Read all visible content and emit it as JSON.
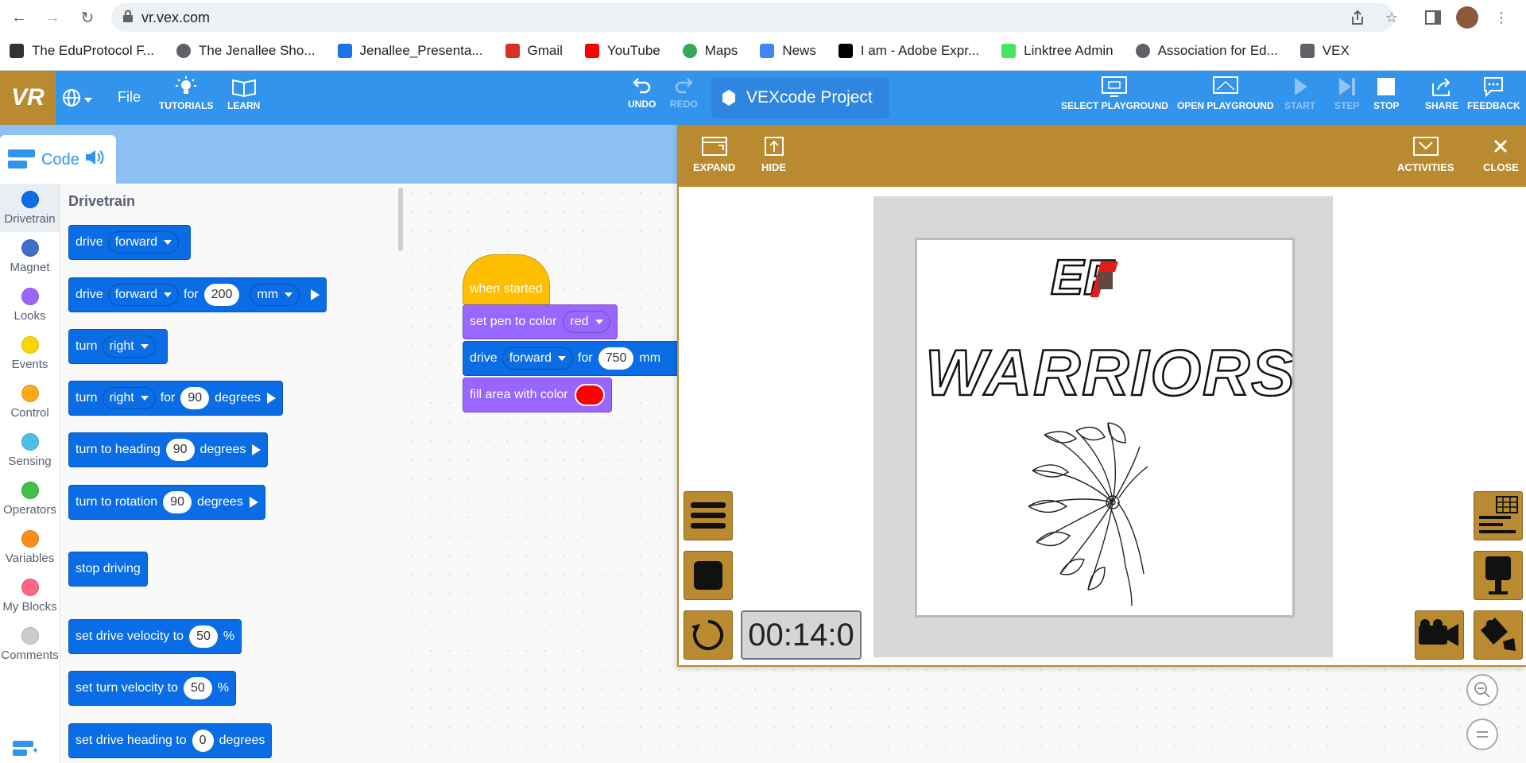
{
  "browser": {
    "url": "vr.vex.com",
    "bookmarks": [
      {
        "label": "The EduProtocol F...",
        "icon": "animal-icon",
        "color": "#333333"
      },
      {
        "label": "The Jenallee Sho...",
        "icon": "globe-icon",
        "color": "#5f6368"
      },
      {
        "label": "Jenallee_Presenta...",
        "icon": "w-logo-icon",
        "color": "#1a73e8"
      },
      {
        "label": "Gmail",
        "icon": "gmail-icon",
        "color": "#d93025"
      },
      {
        "label": "YouTube",
        "icon": "youtube-icon",
        "color": "#ff0000"
      },
      {
        "label": "Maps",
        "icon": "maps-pin-icon",
        "color": "#34a853"
      },
      {
        "label": "News",
        "icon": "news-icon",
        "color": "#4285f4"
      },
      {
        "label": "I am - Adobe Expr...",
        "icon": "adobe-icon",
        "color": "#000000"
      },
      {
        "label": "Linktree Admin",
        "icon": "linktree-icon",
        "color": "#43e660"
      },
      {
        "label": "Association for Ed...",
        "icon": "globe-icon",
        "color": "#5f6368"
      },
      {
        "label": "VEX",
        "icon": "folder-icon",
        "color": "#5f6368"
      }
    ]
  },
  "app": {
    "logo": "VR",
    "file_label": "File",
    "tutorials_label": "TUTORIALS",
    "learn_label": "LEARN",
    "undo_label": "UNDO",
    "redo_label": "REDO",
    "project_name": "VEXcode Project",
    "select_playground_label": "SELECT PLAYGROUND",
    "open_playground_label": "OPEN PLAYGROUND",
    "start_label": "START",
    "step_label": "STEP",
    "stop_label": "STOP",
    "share_label": "SHARE",
    "feedback_label": "FEEDBACK",
    "accent_color": "#3394ee",
    "brand_color": "#b98a30"
  },
  "code_tab": {
    "label": "Code"
  },
  "categories": [
    {
      "label": "Drivetrain",
      "color": "#0a6de6",
      "selected": true
    },
    {
      "label": "Magnet",
      "color": "#3f6fcc"
    },
    {
      "label": "Looks",
      "color": "#9966ff"
    },
    {
      "label": "Events",
      "color": "#ffd500"
    },
    {
      "label": "Control",
      "color": "#ffab19"
    },
    {
      "label": "Sensing",
      "color": "#4cbfe6"
    },
    {
      "label": "Operators",
      "color": "#40bf4a"
    },
    {
      "label": "Variables",
      "color": "#ff8c1a"
    },
    {
      "label": "My Blocks",
      "color": "#ff6680"
    },
    {
      "label": "Comments",
      "color": "#cccccc"
    }
  ],
  "flyout": {
    "heading": "Drivetrain",
    "blocks": {
      "drive": {
        "word": "drive",
        "dir": "forward"
      },
      "drive_for": {
        "word": "drive",
        "dir": "forward",
        "for": "for",
        "value": "200",
        "unit": "mm"
      },
      "turn": {
        "word": "turn",
        "dir": "right"
      },
      "turn_for": {
        "word": "turn",
        "dir": "right",
        "for": "for",
        "value": "90",
        "unit": "degrees"
      },
      "turn_heading": {
        "text": "turn to heading",
        "value": "90",
        "unit": "degrees"
      },
      "turn_rotation": {
        "text": "turn to rotation",
        "value": "90",
        "unit": "degrees"
      },
      "stop": {
        "text": "stop driving"
      },
      "drive_vel": {
        "text": "set drive velocity to",
        "value": "50",
        "unit": "%"
      },
      "turn_vel": {
        "text": "set turn velocity to",
        "value": "50",
        "unit": "%"
      },
      "drive_heading": {
        "text": "set drive heading to",
        "value": "0",
        "unit": "degrees"
      }
    }
  },
  "workspace": {
    "hat": "when started",
    "pen": {
      "text": "set pen to color",
      "color": "red"
    },
    "drive": {
      "word": "drive",
      "dir": "forward",
      "for": "for",
      "value": "750",
      "unit": "mm"
    },
    "fill": {
      "text": "fill area with color",
      "swatch": "#ff0000"
    }
  },
  "playground": {
    "expand_label": "EXPAND",
    "hide_label": "HIDE",
    "activities_label": "ACTIVITIES",
    "close_label": "CLOSE",
    "timer": "00:14:0",
    "canvas": {
      "top_text": "EF",
      "title": "WARRIORS"
    }
  }
}
